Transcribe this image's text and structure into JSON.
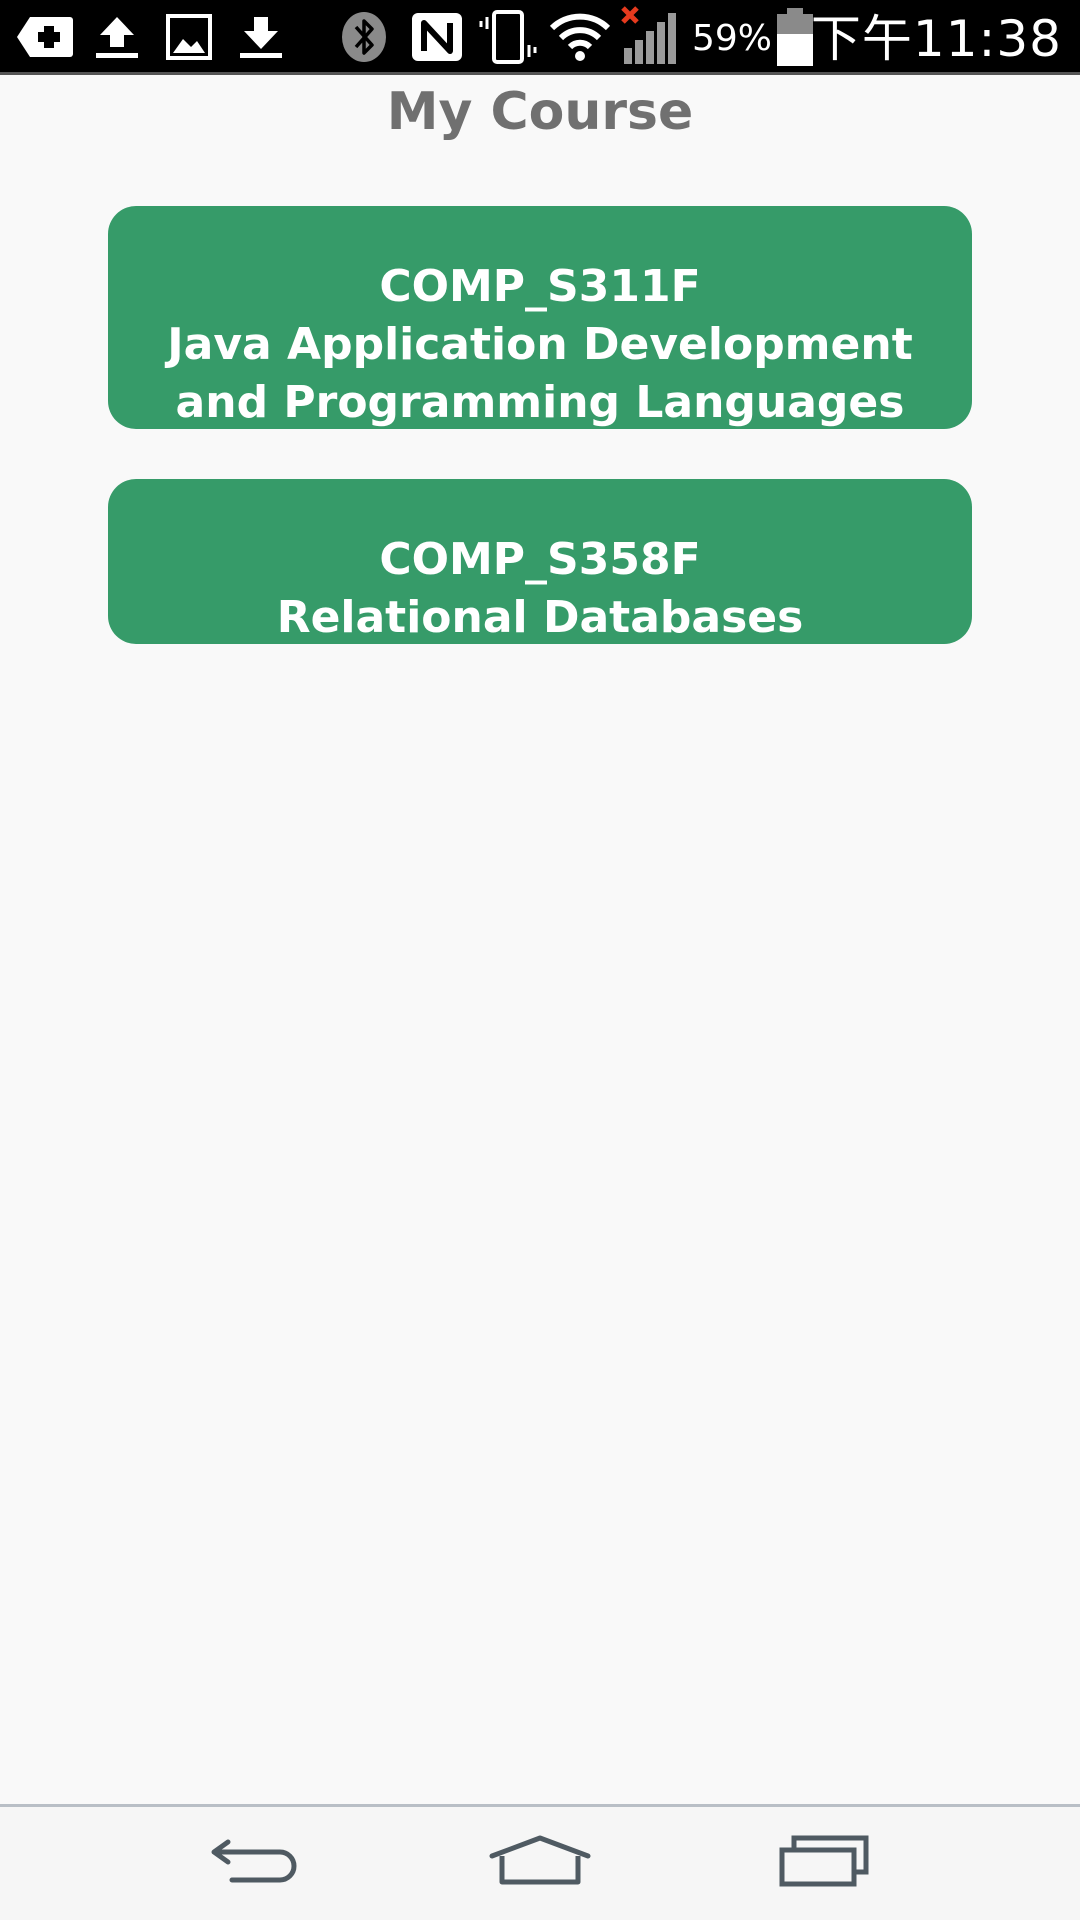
{
  "status_bar": {
    "icons": [
      "medical-cross-icon",
      "upload-icon",
      "image-icon",
      "download-icon",
      "bluetooth-icon",
      "nfc-icon",
      "vibrate-icon",
      "wifi-icon",
      "cellular-signal-no-service-icon",
      "battery-icon"
    ],
    "battery_percent": "59%",
    "time": "下午11:38",
    "colors": {
      "background": "#000000",
      "foreground": "#ffffff",
      "no_service_x": "#e53a1e"
    }
  },
  "header": {
    "title": "My Course"
  },
  "courses": [
    {
      "code": "COMP_S311F",
      "name_line_1": "Java Application Development",
      "name_line_2": "and Programming Languages"
    },
    {
      "code": "COMP_S358F",
      "name_line_1": "Relational Databases"
    }
  ],
  "nav_bar": {
    "icons": [
      "back-icon",
      "home-icon",
      "recent-apps-icon"
    ]
  },
  "colors": {
    "card_background": "#369b69",
    "card_text": "#ffffff",
    "title_text": "#707070",
    "page_background": "#f9f9f9"
  }
}
